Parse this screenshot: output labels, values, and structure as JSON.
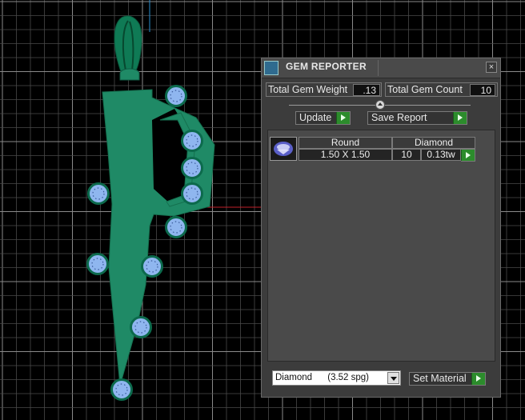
{
  "panel": {
    "title": "GEM REPORTER",
    "close_label": "×",
    "total_weight_label": "Total Gem Weight",
    "total_weight_value": ".13",
    "total_count_label": "Total Gem Count",
    "total_count_value": "10",
    "update_label": "Update",
    "save_report_label": "Save Report",
    "table": {
      "headers": [
        "Round",
        "Diamond"
      ],
      "row": {
        "size": "1.50 X 1.50",
        "count": "10",
        "weight": "0.13tw"
      }
    },
    "material": {
      "selected": "Diamond",
      "density": "(3.52 spg)"
    },
    "set_material_label": "Set Material"
  },
  "colors": {
    "accent_green": "#2c8c2c",
    "model_green": "#1f8a66",
    "gem_blue": "#8fb6ef",
    "axis_red": "#c0202a",
    "axis_blue": "#2a8fd0",
    "grid": "#5e5e5e"
  }
}
